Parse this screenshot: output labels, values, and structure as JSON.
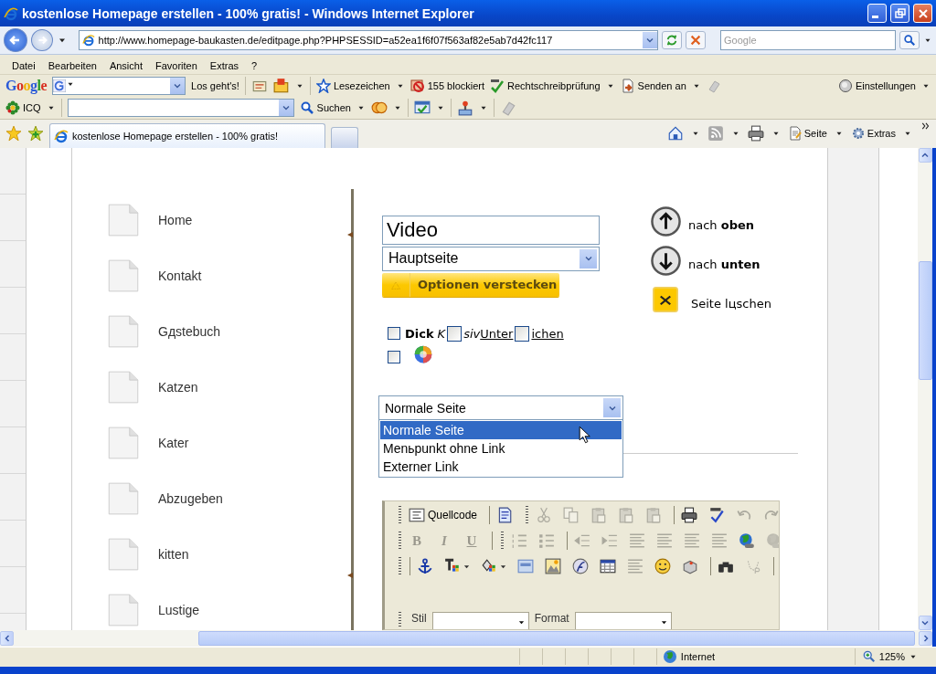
{
  "window": {
    "title": "kostenlose Homepage erstellen - 100% gratis! - Windows Internet Explorer"
  },
  "address_bar": {
    "url": "http://www.homepage-baukasten.de/editpage.php?PHPSESSID=a52ea1f6f07f563af82e5ab7d42fc117",
    "search_placeholder": "Google"
  },
  "menu": [
    "Datei",
    "Bearbeiten",
    "Ansicht",
    "Favoriten",
    "Extras",
    "?"
  ],
  "google_toolbar": {
    "brand": "Google",
    "go": "Los geht's!",
    "items": [
      {
        "kind": "bookmarks",
        "label": "Lesezeichen"
      },
      {
        "kind": "popup",
        "label": "155 blockiert"
      },
      {
        "kind": "spell",
        "label": "Rechtschreibprüfung"
      },
      {
        "kind": "send",
        "label": "Senden an"
      }
    ],
    "settings": "Einstellungen"
  },
  "icq_toolbar": {
    "label": "ICQ",
    "search": "Suchen"
  },
  "tabs": [
    {
      "label": "kostenlose Homepage erstellen - 100% gratis!",
      "selected": true
    }
  ],
  "command_bar": [
    {
      "kind": "page",
      "label": "Seite"
    },
    {
      "kind": "tools",
      "label": "Extras"
    }
  ],
  "nav": [
    "Home",
    "Kontakt",
    "Gдstebuch",
    "Katzen",
    "Kater",
    "Abzugeben",
    "kitten",
    "Lustige"
  ],
  "editor": {
    "title_value": "Video",
    "parent_select": "Hauptseite",
    "options_button": "Optionen verstecken",
    "actions": [
      {
        "kind": "up",
        "label": "nach **oben**"
      },
      {
        "kind": "down",
        "label": "nach **unten**"
      },
      {
        "kind": "delete",
        "label": "Seite lцschen"
      }
    ],
    "format_line": [
      {
        "kind": "checkbox",
        "checked": false
      },
      {
        "kind": "bold",
        "text": "Dick"
      },
      {
        "kind": "italic",
        "text": "K"
      },
      {
        "kind": "checkbox",
        "checked": false
      },
      {
        "kind": "italic",
        "text": "siv"
      },
      {
        "kind": "underline",
        "text": "Unter"
      },
      {
        "kind": "checkbox",
        "checked": false
      },
      {
        "kind": "underline",
        "text": "ichen"
      }
    ],
    "color_checkbox": {
      "checked": false
    },
    "page_type": {
      "value": "Normale Seite",
      "options": [
        {
          "label": "Normale Seite",
          "selected": true
        },
        {
          "label": "Menьpunkt ohne Link",
          "selected": false
        },
        {
          "label": "Externer Link",
          "selected": false
        }
      ]
    },
    "toolbar_rows": [
      [
        {
          "kind": "grip"
        },
        {
          "kind": "button",
          "label": "Quellcode",
          "disabled": false
        },
        {
          "kind": "separator"
        },
        {
          "kind": "button",
          "disabled": false
        },
        {
          "kind": "grip"
        },
        {
          "kind": "button",
          "disabled": true
        },
        {
          "kind": "button",
          "disabled": true
        },
        {
          "kind": "button",
          "disabled": true
        },
        {
          "kind": "button",
          "disabled": true
        },
        {
          "kind": "button",
          "disabled": true
        },
        {
          "kind": "separator"
        },
        {
          "kind": "button",
          "disabled": false
        },
        {
          "kind": "button",
          "disabled": false
        },
        {
          "kind": "button",
          "disabled": true
        },
        {
          "kind": "button",
          "disabled": true
        }
      ],
      [
        {
          "kind": "grip"
        },
        {
          "kind": "button",
          "label": "B",
          "disabled": true
        },
        {
          "kind": "button",
          "label": "I",
          "disabled": true
        },
        {
          "kind": "button",
          "label": "U",
          "disabled": true
        },
        {
          "kind": "separator"
        },
        {
          "kind": "grip"
        },
        {
          "kind": "button",
          "disabled": true
        },
        {
          "kind": "button",
          "disabled": true
        },
        {
          "kind": "separator"
        },
        {
          "kind": "button",
          "disabled": true
        },
        {
          "kind": "button",
          "disabled": true
        },
        {
          "kind": "button",
          "disabled": true
        },
        {
          "kind": "button",
          "disabled": true
        },
        {
          "kind": "button",
          "disabled": true
        },
        {
          "kind": "button",
          "disabled": true
        },
        {
          "kind": "button",
          "disabled": false
        },
        {
          "kind": "button",
          "disabled": true
        }
      ],
      [
        {
          "kind": "grip"
        },
        {
          "kind": "separator"
        },
        {
          "kind": "button",
          "disabled": false
        },
        {
          "kind": "button",
          "disabled": false
        },
        {
          "kind": "button",
          "disabled": false
        },
        {
          "kind": "button",
          "disabled": false
        },
        {
          "kind": "button",
          "disabled": false
        },
        {
          "kind": "button",
          "disabled": false
        },
        {
          "kind": "button",
          "disabled": false
        },
        {
          "kind": "button",
          "disabled": true
        },
        {
          "kind": "button",
          "disabled": false
        },
        {
          "kind": "button",
          "disabled": false
        },
        {
          "kind": "separator"
        },
        {
          "kind": "button",
          "disabled": false
        },
        {
          "kind": "button",
          "disabled": true
        },
        {
          "kind": "separator"
        }
      ]
    ],
    "style_row": [
      {
        "label": "Stil"
      },
      {
        "label": "Format"
      }
    ]
  },
  "status_bar": {
    "zone": "Internet",
    "zoom": "125%"
  }
}
